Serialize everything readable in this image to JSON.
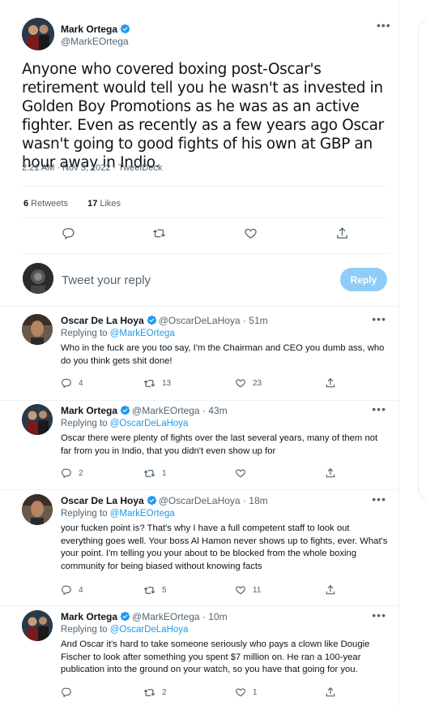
{
  "main": {
    "author_name": "Mark Ortega",
    "author_handle": "@MarkEOrtega",
    "text": "Anyone who covered boxing post-Oscar's retirement would tell you he wasn't as invested in Golden Boy Promotions as he was as an active fighter. Even as recently as a few years ago Oscar wasn't going to good fights of his own at GBP an hour away in Indio.",
    "time": "2:21 AM",
    "date": "Nov 3, 2022",
    "source": "TweetDeck",
    "retweets_count": "6",
    "retweets_label": "Retweets",
    "likes_count": "17",
    "likes_label": "Likes",
    "more_icon": "more-icon"
  },
  "compose": {
    "placeholder": "Tweet your reply",
    "reply_button": "Reply"
  },
  "colors": {
    "accent": "#1d9bf0",
    "reply_button_disabled": "#8ecdf7",
    "text": "#0f1419",
    "secondary": "#536471"
  },
  "replies": [
    {
      "name": "Oscar De La Hoya",
      "handle": "@OscarDeLaHoya",
      "age": "51m",
      "replying_label": "Replying to",
      "replying_to": "@MarkEOrtega",
      "text": "Who in the fuck are you too say, I'm the Chairman and CEO you dumb ass, who do you think gets shit done!",
      "replies": "4",
      "retweets": "13",
      "likes": "23"
    },
    {
      "name": "Mark Ortega",
      "handle": "@MarkEOrtega",
      "age": "43m",
      "replying_label": "Replying to",
      "replying_to": "@OscarDeLaHoya",
      "text": "Oscar there were plenty of fights over the last several years, many of them not far from you in Indio, that you didn't even show up for",
      "replies": "2",
      "retweets": "1",
      "likes": ""
    },
    {
      "name": "Oscar De La Hoya",
      "handle": "@OscarDeLaHoya",
      "age": "18m",
      "replying_label": "Replying to",
      "replying_to": "@MarkEOrtega",
      "text": "your fucken point is? That's why I have a full competent staff to look out everything goes well. Your boss Al Hamon never shows up to fights, ever. What's your point. I'm telling you your about to be blocked from the whole boxing community for being biased without knowing facts",
      "replies": "4",
      "retweets": "5",
      "likes": "11"
    },
    {
      "name": "Mark Ortega",
      "handle": "@MarkEOrtega",
      "age": "10m",
      "replying_label": "Replying to",
      "replying_to": "@OscarDeLaHoya",
      "text": "And Oscar it's hard to take someone seriously who pays a clown like Dougie Fischer to look after something you spent $7 million on. He ran a 100-year publication into the ground on your watch, so you have that going for you.",
      "replies": "",
      "retweets": "2",
      "likes": "1"
    }
  ]
}
